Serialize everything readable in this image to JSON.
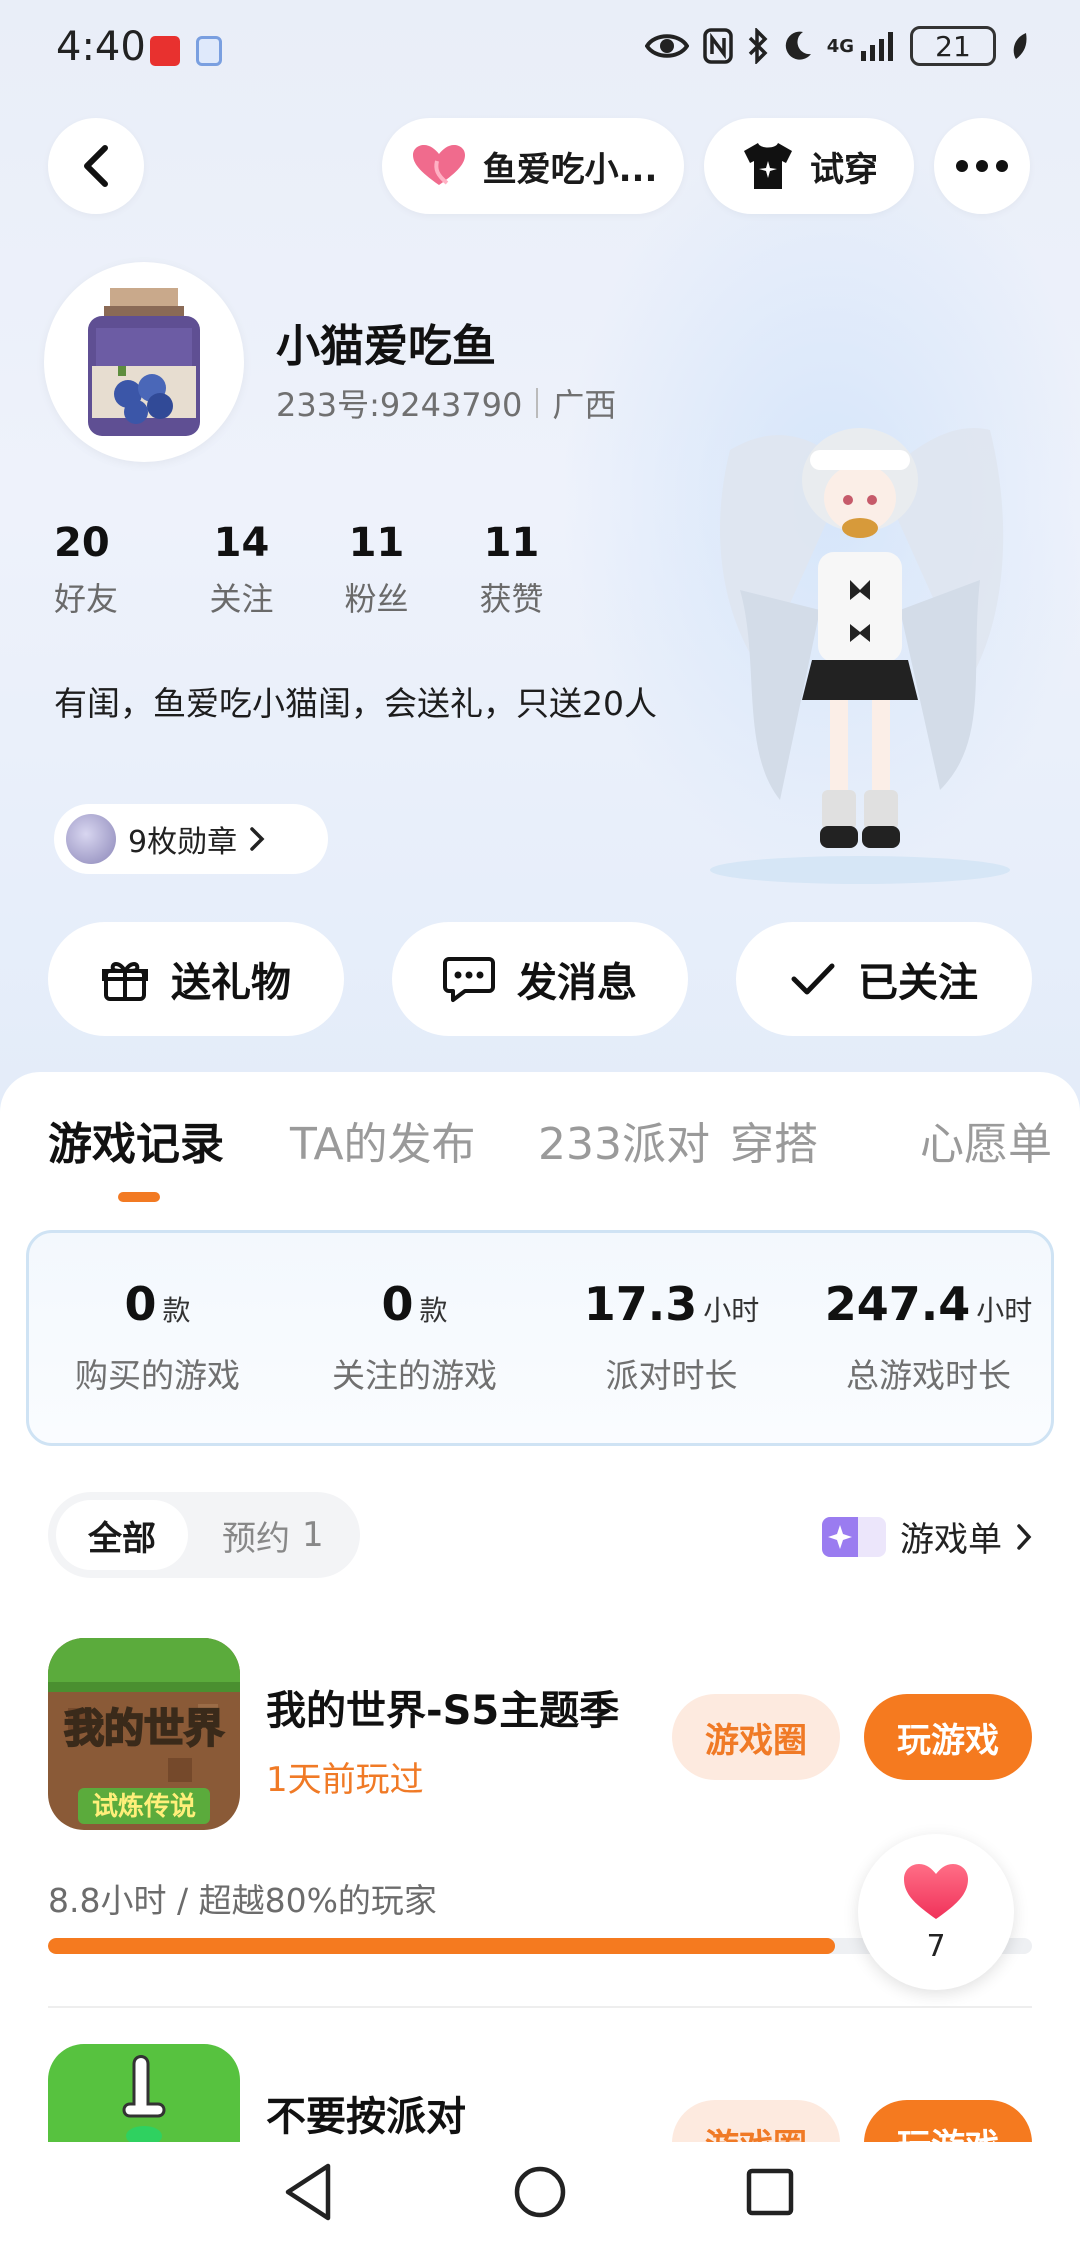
{
  "status_bar": {
    "time": "4:40",
    "signal_text": "4G",
    "battery": "21"
  },
  "header": {
    "friend_chip_label": "鱼爱吃小...",
    "tryon_label": "试穿"
  },
  "profile": {
    "nickname": "小猫爱吃鱼",
    "uid": "233号:9243790",
    "region": "广西",
    "stats": [
      {
        "value": "20",
        "label": "好友"
      },
      {
        "value": "14",
        "label": "关注"
      },
      {
        "value": "11",
        "label": "粉丝"
      },
      {
        "value": "11",
        "label": "获赞"
      }
    ],
    "bio": "有闺，鱼爱吃小猫闺，会送礼，只送20人",
    "medals_label": "9枚勋章"
  },
  "actions": {
    "gift": "送礼物",
    "message": "发消息",
    "follow": "已关注"
  },
  "tabs": [
    "游戏记录",
    "TA的发布",
    "233派对",
    "穿搭",
    "心愿单"
  ],
  "summary": [
    {
      "value": "0",
      "unit": "款",
      "label": "购买的游戏"
    },
    {
      "value": "0",
      "unit": "款",
      "label": "关注的游戏"
    },
    {
      "value": "17.3",
      "unit": "小时",
      "label": "派对时长"
    },
    {
      "value": "247.4",
      "unit": "小时",
      "label": "总游戏时长"
    }
  ],
  "filters": {
    "all": "全部",
    "reserve": "预约",
    "reserve_count": "1",
    "gamelist": "游戏单"
  },
  "games": [
    {
      "title": "我的世界-S5主题季",
      "icon_text_top": "我的世界",
      "icon_text_bottom": "试炼传说",
      "last_played": "1天前玩过",
      "circle_btn": "游戏圈",
      "play_btn": "玩游戏",
      "playtime": "8.8小时 / 超越80%的玩家",
      "progress": 0.8
    },
    {
      "title": "不要按派对",
      "circle_btn": "游戏圈",
      "play_btn": "玩游戏"
    }
  ],
  "like_float": {
    "count": "7"
  },
  "colors": {
    "accent_orange": "#f57a1f",
    "soft_orange": "#fdeadf",
    "card_border": "#cfe3f4"
  }
}
